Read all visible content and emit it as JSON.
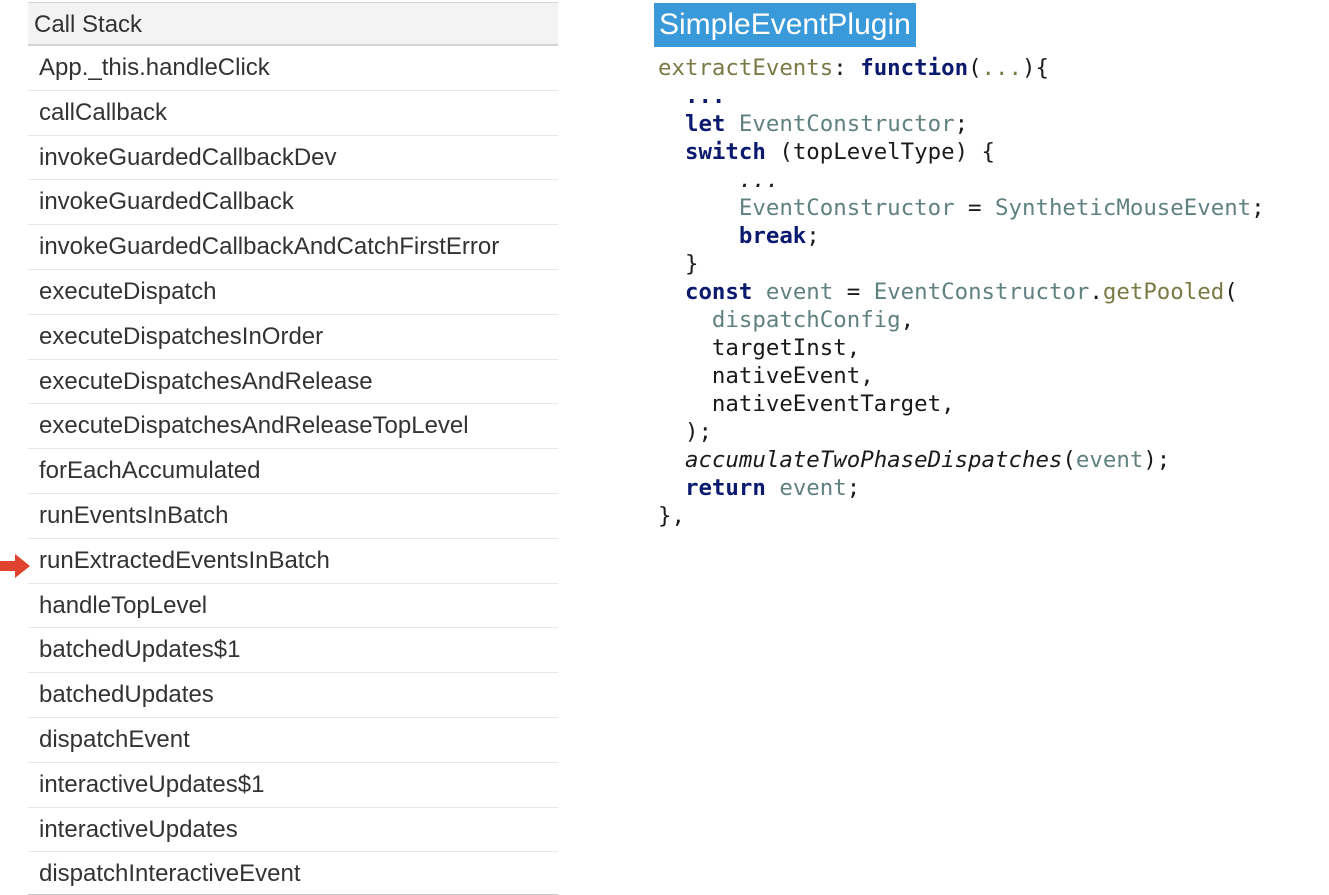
{
  "call_stack": {
    "title": "Call Stack",
    "frames": [
      "App._this.handleClick",
      "callCallback",
      "invokeGuardedCallbackDev",
      "invokeGuardedCallback",
      "invokeGuardedCallbackAndCatchFirstError",
      "executeDispatch",
      "executeDispatchesInOrder",
      "executeDispatchesAndRelease",
      "executeDispatchesAndReleaseTopLevel",
      "forEachAccumulated",
      "runEventsInBatch",
      "runExtractedEventsInBatch",
      "handleTopLevel",
      "batchedUpdates$1",
      "batchedUpdates",
      "dispatchEvent",
      "interactiveUpdates$1",
      "interactiveUpdates",
      "dispatchInteractiveEvent"
    ],
    "current_frame_index": 11,
    "arrow_color": "#e0432d"
  },
  "code_panel": {
    "title": "SimpleEventPlugin",
    "title_bg": "#3a9ad9",
    "lines": [
      [
        [
          "fn",
          "extractEvents"
        ],
        [
          "pl",
          ": "
        ],
        [
          "kw",
          "function"
        ],
        [
          "pl",
          "("
        ],
        [
          "fn",
          "..."
        ],
        [
          "pl",
          "){"
        ]
      ],
      [
        [
          "pl",
          "  "
        ],
        [
          "kw",
          "..."
        ]
      ],
      [
        [
          "pl",
          "  "
        ],
        [
          "kw",
          "let"
        ],
        [
          "pl",
          " "
        ],
        [
          "id",
          "EventConstructor"
        ],
        [
          "pl",
          ";"
        ]
      ],
      [
        [
          "pl",
          "  "
        ],
        [
          "kw",
          "switch"
        ],
        [
          "pl",
          " (topLevelType) {"
        ]
      ],
      [
        [
          "pl",
          "    "
        ],
        [
          "it",
          "  ..."
        ]
      ],
      [
        [
          "pl",
          "      "
        ],
        [
          "id",
          "EventConstructor"
        ],
        [
          "pl",
          " = "
        ],
        [
          "id",
          "SyntheticMouseEvent"
        ],
        [
          "pl",
          ";"
        ]
      ],
      [
        [
          "pl",
          "      "
        ],
        [
          "kw",
          "break"
        ],
        [
          "pl",
          ";"
        ]
      ],
      [
        [
          "pl",
          "  }"
        ]
      ],
      [
        [
          "pl",
          "  "
        ],
        [
          "kw",
          "const"
        ],
        [
          "pl",
          " "
        ],
        [
          "id",
          "event"
        ],
        [
          "pl",
          " = "
        ],
        [
          "id",
          "EventConstructor"
        ],
        [
          "pl",
          "."
        ],
        [
          "fn",
          "getPooled"
        ],
        [
          "pl",
          "("
        ]
      ],
      [
        [
          "pl",
          "    "
        ],
        [
          "id",
          "dispatchConfig"
        ],
        [
          "pl",
          ","
        ]
      ],
      [
        [
          "pl",
          "    targetInst,"
        ]
      ],
      [
        [
          "pl",
          "    nativeEvent,"
        ]
      ],
      [
        [
          "pl",
          "    nativeEventTarget,"
        ]
      ],
      [
        [
          "pl",
          "  );"
        ]
      ],
      [
        [
          "pl",
          "  "
        ],
        [
          "it",
          "accumulateTwoPhaseDispatches"
        ],
        [
          "pl",
          "("
        ],
        [
          "id",
          "event"
        ],
        [
          "pl",
          ");"
        ]
      ],
      [
        [
          "pl",
          "  "
        ],
        [
          "kw",
          "return"
        ],
        [
          "pl",
          " "
        ],
        [
          "id",
          "event"
        ],
        [
          "pl",
          ";"
        ]
      ],
      [
        [
          "pl",
          "},"
        ]
      ]
    ]
  }
}
